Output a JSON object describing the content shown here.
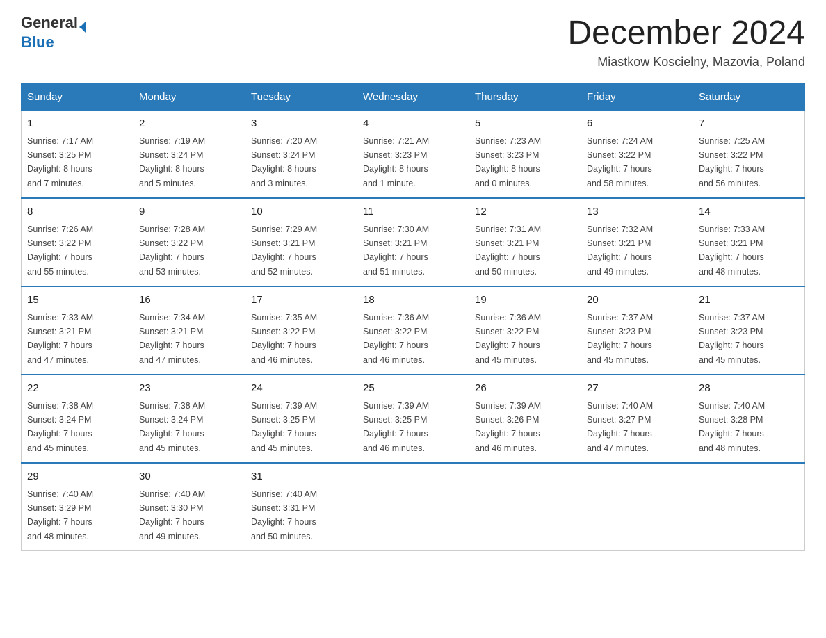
{
  "header": {
    "logo_general": "General",
    "logo_blue": "Blue",
    "month_title": "December 2024",
    "location": "Miastkow Koscielny, Mazovia, Poland"
  },
  "days_of_week": [
    "Sunday",
    "Monday",
    "Tuesday",
    "Wednesday",
    "Thursday",
    "Friday",
    "Saturday"
  ],
  "weeks": [
    [
      {
        "day": "1",
        "sunrise": "7:17 AM",
        "sunset": "3:25 PM",
        "daylight": "8 hours and 7 minutes."
      },
      {
        "day": "2",
        "sunrise": "7:19 AM",
        "sunset": "3:24 PM",
        "daylight": "8 hours and 5 minutes."
      },
      {
        "day": "3",
        "sunrise": "7:20 AM",
        "sunset": "3:24 PM",
        "daylight": "8 hours and 3 minutes."
      },
      {
        "day": "4",
        "sunrise": "7:21 AM",
        "sunset": "3:23 PM",
        "daylight": "8 hours and 1 minute."
      },
      {
        "day": "5",
        "sunrise": "7:23 AM",
        "sunset": "3:23 PM",
        "daylight": "8 hours and 0 minutes."
      },
      {
        "day": "6",
        "sunrise": "7:24 AM",
        "sunset": "3:22 PM",
        "daylight": "7 hours and 58 minutes."
      },
      {
        "day": "7",
        "sunrise": "7:25 AM",
        "sunset": "3:22 PM",
        "daylight": "7 hours and 56 minutes."
      }
    ],
    [
      {
        "day": "8",
        "sunrise": "7:26 AM",
        "sunset": "3:22 PM",
        "daylight": "7 hours and 55 minutes."
      },
      {
        "day": "9",
        "sunrise": "7:28 AM",
        "sunset": "3:22 PM",
        "daylight": "7 hours and 53 minutes."
      },
      {
        "day": "10",
        "sunrise": "7:29 AM",
        "sunset": "3:21 PM",
        "daylight": "7 hours and 52 minutes."
      },
      {
        "day": "11",
        "sunrise": "7:30 AM",
        "sunset": "3:21 PM",
        "daylight": "7 hours and 51 minutes."
      },
      {
        "day": "12",
        "sunrise": "7:31 AM",
        "sunset": "3:21 PM",
        "daylight": "7 hours and 50 minutes."
      },
      {
        "day": "13",
        "sunrise": "7:32 AM",
        "sunset": "3:21 PM",
        "daylight": "7 hours and 49 minutes."
      },
      {
        "day": "14",
        "sunrise": "7:33 AM",
        "sunset": "3:21 PM",
        "daylight": "7 hours and 48 minutes."
      }
    ],
    [
      {
        "day": "15",
        "sunrise": "7:33 AM",
        "sunset": "3:21 PM",
        "daylight": "7 hours and 47 minutes."
      },
      {
        "day": "16",
        "sunrise": "7:34 AM",
        "sunset": "3:21 PM",
        "daylight": "7 hours and 47 minutes."
      },
      {
        "day": "17",
        "sunrise": "7:35 AM",
        "sunset": "3:22 PM",
        "daylight": "7 hours and 46 minutes."
      },
      {
        "day": "18",
        "sunrise": "7:36 AM",
        "sunset": "3:22 PM",
        "daylight": "7 hours and 46 minutes."
      },
      {
        "day": "19",
        "sunrise": "7:36 AM",
        "sunset": "3:22 PM",
        "daylight": "7 hours and 45 minutes."
      },
      {
        "day": "20",
        "sunrise": "7:37 AM",
        "sunset": "3:23 PM",
        "daylight": "7 hours and 45 minutes."
      },
      {
        "day": "21",
        "sunrise": "7:37 AM",
        "sunset": "3:23 PM",
        "daylight": "7 hours and 45 minutes."
      }
    ],
    [
      {
        "day": "22",
        "sunrise": "7:38 AM",
        "sunset": "3:24 PM",
        "daylight": "7 hours and 45 minutes."
      },
      {
        "day": "23",
        "sunrise": "7:38 AM",
        "sunset": "3:24 PM",
        "daylight": "7 hours and 45 minutes."
      },
      {
        "day": "24",
        "sunrise": "7:39 AM",
        "sunset": "3:25 PM",
        "daylight": "7 hours and 45 minutes."
      },
      {
        "day": "25",
        "sunrise": "7:39 AM",
        "sunset": "3:25 PM",
        "daylight": "7 hours and 46 minutes."
      },
      {
        "day": "26",
        "sunrise": "7:39 AM",
        "sunset": "3:26 PM",
        "daylight": "7 hours and 46 minutes."
      },
      {
        "day": "27",
        "sunrise": "7:40 AM",
        "sunset": "3:27 PM",
        "daylight": "7 hours and 47 minutes."
      },
      {
        "day": "28",
        "sunrise": "7:40 AM",
        "sunset": "3:28 PM",
        "daylight": "7 hours and 48 minutes."
      }
    ],
    [
      {
        "day": "29",
        "sunrise": "7:40 AM",
        "sunset": "3:29 PM",
        "daylight": "7 hours and 48 minutes."
      },
      {
        "day": "30",
        "sunrise": "7:40 AM",
        "sunset": "3:30 PM",
        "daylight": "7 hours and 49 minutes."
      },
      {
        "day": "31",
        "sunrise": "7:40 AM",
        "sunset": "3:31 PM",
        "daylight": "7 hours and 50 minutes."
      },
      null,
      null,
      null,
      null
    ]
  ],
  "labels": {
    "sunrise": "Sunrise:",
    "sunset": "Sunset:",
    "daylight": "Daylight:"
  }
}
